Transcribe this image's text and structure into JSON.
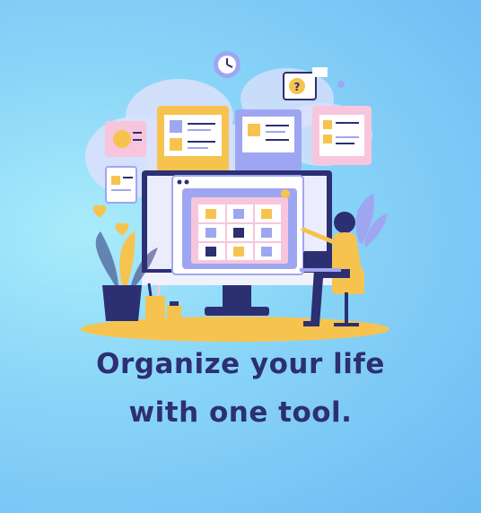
{
  "headline": {
    "line1": "Organize your life",
    "line2": "with one tool."
  },
  "colors": {
    "background_light": "#a9ecfb",
    "background_dark": "#6db9f3",
    "headline_text": "#2d2f73",
    "accent_yellow": "#f7c34f",
    "accent_navy": "#2d2f73",
    "accent_pink": "#f7c6dc",
    "accent_lavender": "#9fa6f1"
  },
  "icons": [
    "clock-icon",
    "question-icon",
    "plant-icon",
    "laptop-icon",
    "heart-icon"
  ]
}
